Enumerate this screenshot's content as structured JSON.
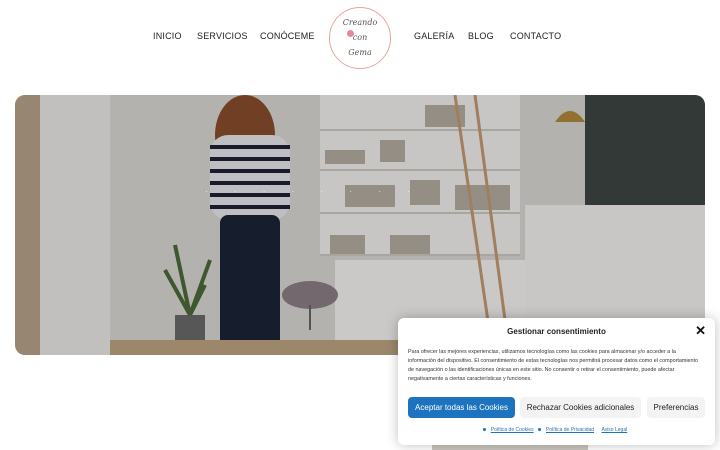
{
  "nav": {
    "items_left": [
      "INICIO",
      "SERVICIOS",
      "CONÓCEME"
    ],
    "items_right": [
      "GALERÍA",
      "BLOG",
      "CONTACTO"
    ],
    "logo": {
      "line1": "Creando",
      "line2": "con",
      "line3": "Gema"
    }
  },
  "hero": {
    "headline": "· · · · · · · ·"
  },
  "cookie": {
    "title": "Gestionar consentimiento",
    "close": "✕",
    "body": "Para ofrecer las mejores experiencias, utilizamos tecnologías como las cookies para almacenar y/o acceder a la información del dispositivo. El consentimiento de estas tecnologías nos permitirá procesar datos como el comportamiento de navegación o las identificaciones únicas en este sitio. No consentir o retirar el consentimiento, puede afectar negativamente a ciertas características y funciones.",
    "accept": "Aceptar todas las Cookies",
    "reject": "Rechazar Cookies adicionales",
    "preferences": "Preferencias",
    "links": [
      "Política de Cookies",
      "Política de Privacidad",
      "Aviso Legal"
    ]
  }
}
